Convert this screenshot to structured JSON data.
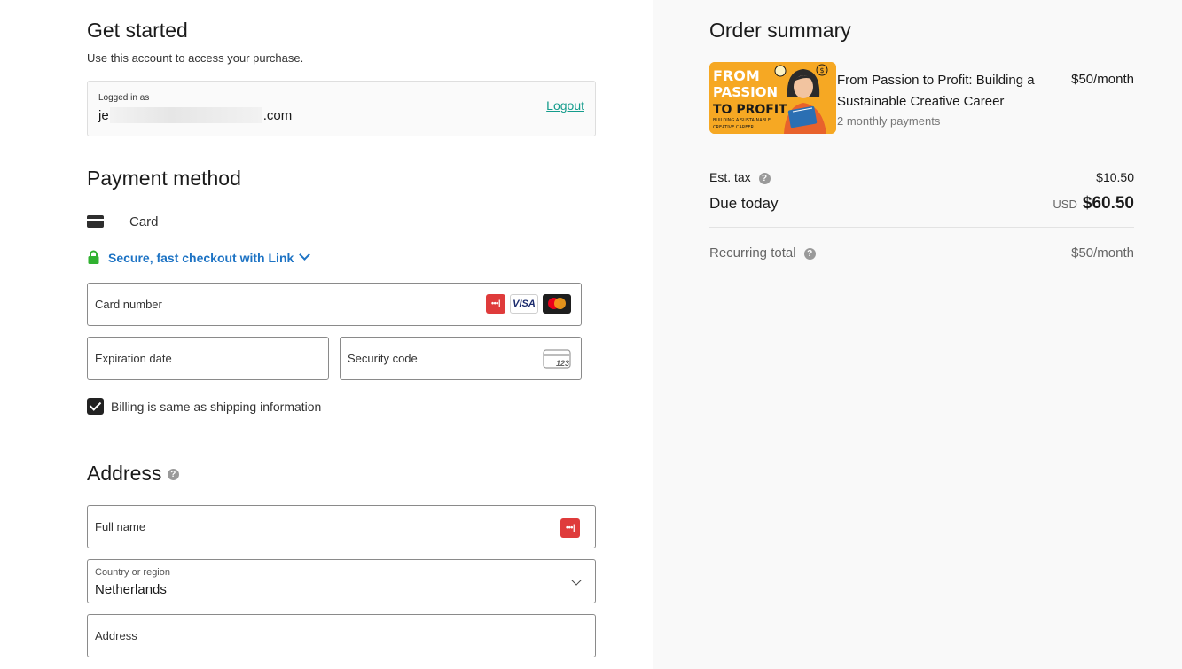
{
  "account": {
    "heading": "Get started",
    "subtitle": "Use this account to access your purchase.",
    "logged_in_label": "Logged in as",
    "email_prefix": "je",
    "email_suffix": ".com",
    "logout_label": "Logout"
  },
  "payment": {
    "heading": "Payment method",
    "card_label": "Card",
    "link_label": "Secure, fast checkout with Link",
    "card_number_placeholder": "Card number",
    "expiration_placeholder": "Expiration date",
    "security_code_placeholder": "Security code",
    "cvc_icon_text": "123",
    "brand_visa": "VISA",
    "brand_dots": "•••|",
    "billing_same_label": "Billing is same as shipping information"
  },
  "address": {
    "heading": "Address",
    "full_name_placeholder": "Full name",
    "country_label": "Country or region",
    "country_value": "Netherlands",
    "address_placeholder": "Address"
  },
  "order": {
    "heading": "Order summary",
    "product_title": "From Passion to Profit: Building a Sustainable Creative Career",
    "product_sub": "2 monthly payments",
    "product_price": "$50/month",
    "image_text": {
      "line1": "FROM",
      "line2": "PASSION",
      "line3": "TO PROFIT",
      "line4": "BUILDING A SUSTAINABLE",
      "line5": "CREATIVE CAREER"
    },
    "tax_label": "Est. tax",
    "tax_value": "$10.50",
    "due_label": "Due today",
    "due_currency": "USD",
    "due_value": "$60.50",
    "recurring_label": "Recurring total",
    "recurring_value": "$50/month"
  },
  "colors": {
    "link_blue": "#1d73c4",
    "logout_teal": "#149c8c",
    "lock_green": "#30b130",
    "panel_bg": "#f9f9f9"
  },
  "icons": [
    "card-icon",
    "lock-icon",
    "chevron-down-icon",
    "help-icon",
    "cvc-card-icon",
    "link-dots-icon",
    "visa-icon",
    "mastercard-icon"
  ]
}
